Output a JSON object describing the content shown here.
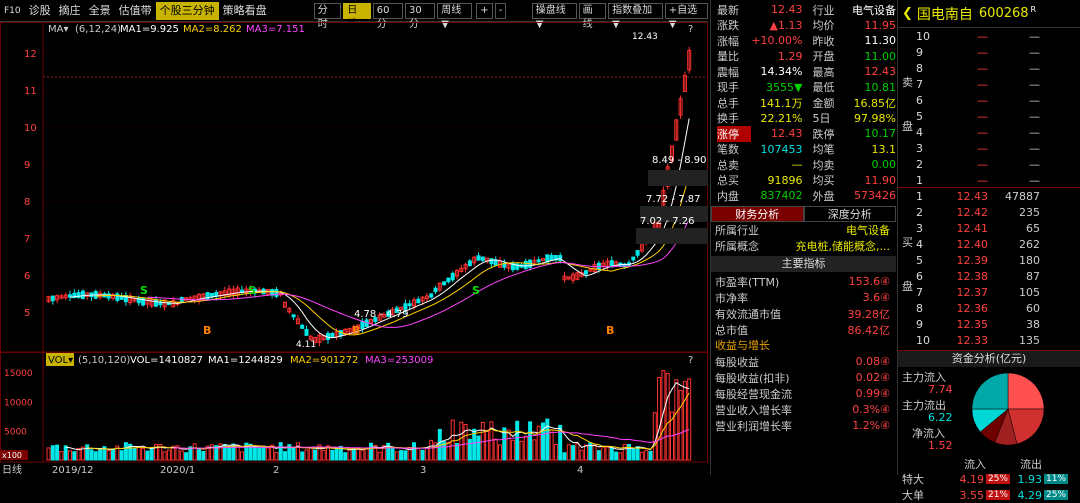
{
  "toolbar": {
    "f10": "F10",
    "items": [
      "诊股",
      "摘庄",
      "全景",
      "估值带",
      "个股三分钟",
      "策略看盘"
    ],
    "active": "个股三分钟",
    "periods": [
      "分时",
      "日线",
      "60分",
      "30分",
      "周线▼"
    ],
    "active_period": "日线",
    "plus": "+",
    "minus": "-",
    "right_items": [
      "操盘线▼",
      "画线",
      "指数叠加▼",
      "+自选▼"
    ]
  },
  "kline": {
    "ma_label": "MA▾",
    "ma_params": "(6,12,24)",
    "ma1": "MA1=9.925",
    "ma2": "MA2=8.262",
    "ma3": "MA3=7.151",
    "high_label": "12.43",
    "low_label": "4.11",
    "range_labels": [
      "8.49 - 8.90",
      "7.72 - 7.87",
      "7.02 - 7.26",
      "4.78 - 4.79"
    ],
    "y_ticks": [
      "12",
      "11",
      "10",
      "9",
      "8",
      "7",
      "6",
      "5"
    ],
    "colors": {
      "up": "#ff3030",
      "down": "#00e8e8",
      "ma1": "#ffffff",
      "ma2": "#ffd000",
      "ma3": "#ff44ff"
    }
  },
  "volume": {
    "label": "VOL▾",
    "params": "(5,10,120)",
    "vol": "VOL=1410827",
    "ma1": "MA1=1244829",
    "ma2": "MA2=901272",
    "ma3": "MA3=253009",
    "y_ticks": [
      "15000",
      "10000",
      "5000"
    ],
    "unit": "x100"
  },
  "xaxis": {
    "labels": [
      "日线",
      "2019/12",
      "2020/1",
      "2",
      "3",
      "4"
    ]
  },
  "quote": {
    "rows": [
      {
        "k": "最新",
        "v": "12.43",
        "vc": "red",
        "k2": "行业",
        "v2": "电气设备",
        "v2c": "white"
      },
      {
        "k": "涨跌",
        "v": "▲1.13",
        "vc": "red",
        "k2": "均价",
        "v2": "11.95",
        "v2c": "red"
      },
      {
        "k": "涨幅",
        "v": "+10.00%",
        "vc": "red",
        "k2": "昨收",
        "v2": "11.30",
        "v2c": "white"
      },
      {
        "k": "量比",
        "v": "1.29",
        "vc": "red",
        "k2": "开盘",
        "v2": "11.00",
        "v2c": "green"
      },
      {
        "k": "震幅",
        "v": "14.34%",
        "vc": "white",
        "k2": "最高",
        "v2": "12.43",
        "v2c": "red"
      },
      {
        "k": "现手",
        "v": "3555▼",
        "vc": "green",
        "k2": "最低",
        "v2": "10.81",
        "v2c": "green"
      },
      {
        "k": "总手",
        "v": "141.1万",
        "vc": "yellow",
        "k2": "金额",
        "v2": "16.85亿",
        "v2c": "yellow"
      },
      {
        "k": "换手",
        "v": "22.21%",
        "vc": "yellow",
        "k2": "5日",
        "v2": "97.98%",
        "v2c": "yellow"
      },
      {
        "k": "涨停",
        "v": "12.43",
        "vc": "red",
        "k2": "跌停",
        "v2": "10.17",
        "v2c": "green"
      },
      {
        "k": "笔数",
        "v": "107453",
        "vc": "cyan",
        "k2": "均笔",
        "v2": "13.1",
        "v2c": "yellow"
      },
      {
        "k": "总卖",
        "v": "—",
        "vc": "yellow",
        "k2": "均卖",
        "v2": "0.00",
        "v2c": "green"
      },
      {
        "k": "总买",
        "v": "91896",
        "vc": "yellow",
        "k2": "均买",
        "v2": "11.90",
        "v2c": "red"
      },
      {
        "k": "内盘",
        "v": "837402",
        "vc": "green",
        "k2": "外盘",
        "v2": "573426",
        "v2c": "red"
      }
    ],
    "tabs": [
      "财务分析",
      "深度分析"
    ],
    "industry_k": "所属行业",
    "industry_v": "电气设备",
    "concept_k": "所属概念",
    "concept_v": "充电桩,储能概念,...",
    "main_header": "主要指标",
    "metrics": [
      {
        "k": "市盈率(TTM)",
        "v": "153.6④"
      },
      {
        "k": "市净率",
        "v": "3.6④"
      },
      {
        "k": "有效流通市值",
        "v": "39.28亿"
      },
      {
        "k": "总市值",
        "v": "86.42亿"
      }
    ],
    "growth_header": "收益与增长",
    "growth": [
      {
        "k": "每股收益",
        "v": "0.08④"
      },
      {
        "k": "每股收益(扣非)",
        "v": "0.02④"
      },
      {
        "k": "每股经营现金流",
        "v": "0.99④"
      },
      {
        "k": "营业收入增长率",
        "v": "0.3%④"
      },
      {
        "k": "营业利润增长率",
        "v": "1.2%④"
      }
    ]
  },
  "stock": {
    "name": "国电南自",
    "code": "600268",
    "suffix": "R"
  },
  "orderbook": {
    "sell_label": "卖",
    "sell_label2": "盘",
    "buy_label": "买",
    "buy_label2": "盘",
    "sells": [
      {
        "n": "10",
        "p": "—",
        "v": "—"
      },
      {
        "n": "9",
        "p": "—",
        "v": "—"
      },
      {
        "n": "8",
        "p": "—",
        "v": "—"
      },
      {
        "n": "7",
        "p": "—",
        "v": "—"
      },
      {
        "n": "6",
        "p": "—",
        "v": "—"
      },
      {
        "n": "5",
        "p": "—",
        "v": "—"
      },
      {
        "n": "4",
        "p": "—",
        "v": "—"
      },
      {
        "n": "3",
        "p": "—",
        "v": "—"
      },
      {
        "n": "2",
        "p": "—",
        "v": "—"
      },
      {
        "n": "1",
        "p": "—",
        "v": "—"
      }
    ],
    "buys": [
      {
        "n": "1",
        "p": "12.43",
        "v": "47887"
      },
      {
        "n": "2",
        "p": "12.42",
        "v": "235"
      },
      {
        "n": "3",
        "p": "12.41",
        "v": "65"
      },
      {
        "n": "4",
        "p": "12.40",
        "v": "262"
      },
      {
        "n": "5",
        "p": "12.39",
        "v": "180"
      },
      {
        "n": "6",
        "p": "12.38",
        "v": "87"
      },
      {
        "n": "7",
        "p": "12.37",
        "v": "105"
      },
      {
        "n": "8",
        "p": "12.36",
        "v": "60"
      },
      {
        "n": "9",
        "p": "12.35",
        "v": "38"
      },
      {
        "n": "10",
        "p": "12.33",
        "v": "135"
      }
    ]
  },
  "capital": {
    "header": "资金分析(亿元)",
    "main_in_k": "主力流入",
    "main_in_v": "7.74",
    "main_out_k": "主力流出",
    "main_out_v": "6.22",
    "net_k": "净流入",
    "net_v": "1.52",
    "col_in": "流入",
    "col_out": "流出",
    "rows": [
      {
        "k": "特大",
        "in": "4.19",
        "inp": "25%",
        "out": "1.93",
        "outp": "11%"
      },
      {
        "k": "大单",
        "in": "3.55",
        "inp": "21%",
        "out": "4.29",
        "outp": "25%"
      }
    ],
    "pie": [
      {
        "value": 25,
        "color": "#ff5050"
      },
      {
        "value": 21,
        "color": "#d03030"
      },
      {
        "value": 10,
        "color": "#a02020"
      },
      {
        "value": 8,
        "color": "#700000"
      },
      {
        "value": 11,
        "color": "#00d8d8"
      },
      {
        "value": 25,
        "color": "#00a8a8"
      }
    ]
  }
}
